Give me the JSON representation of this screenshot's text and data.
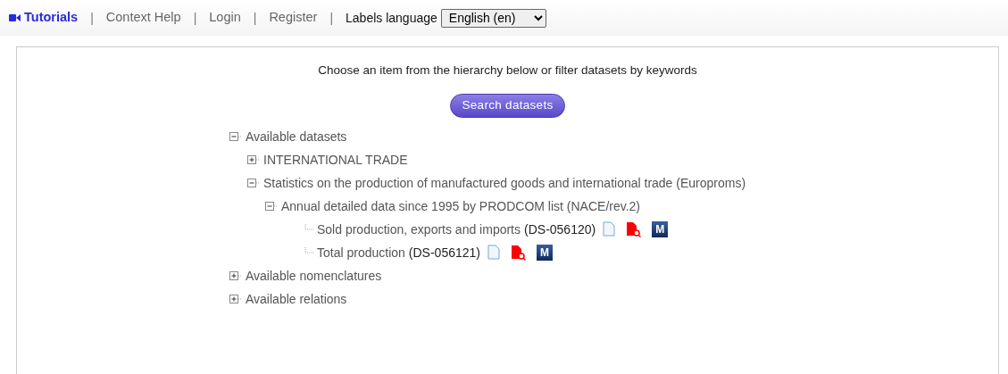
{
  "top_nav": {
    "links": [
      {
        "label": "Tutorials",
        "kind": "video",
        "selected": true
      },
      {
        "label": "Context Help",
        "kind": "plain",
        "selected": false
      },
      {
        "label": "Login",
        "kind": "plain",
        "selected": false
      },
      {
        "label": "Register",
        "kind": "plain",
        "selected": false
      }
    ],
    "separator": "|",
    "language_label": "Labels language",
    "language_value": "English (en)"
  },
  "panel": {
    "instruction": "Choose an item from the hierarchy below or filter datasets by keywords",
    "search_button": "Search datasets",
    "tree": [
      {
        "label": "Available datasets",
        "expanded": true,
        "children": [
          {
            "label": "INTERNATIONAL TRADE",
            "expanded": false
          },
          {
            "label": "Statistics on the production of manufactured goods and international trade (Europroms)",
            "expanded": true,
            "children": [
              {
                "label": "Annual detailed data since 1995 by PRODCOM list (NACE/rev.2)",
                "expanded": true,
                "children": [
                  {
                    "label": "Sold production, exports and imports",
                    "code": "(DS-056120)",
                    "badge": "M"
                  },
                  {
                    "label": "Total production",
                    "code": "(DS-056121)",
                    "badge": "M"
                  }
                ]
              }
            ]
          }
        ]
      },
      {
        "label": "Available nomenclatures",
        "expanded": false
      },
      {
        "label": "Available relations",
        "expanded": false
      }
    ]
  }
}
